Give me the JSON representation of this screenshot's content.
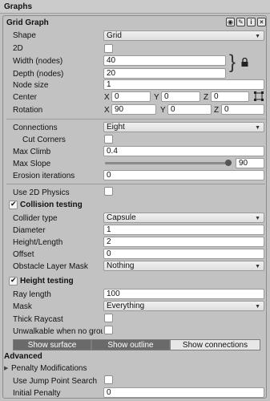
{
  "window": {
    "title": "Graphs"
  },
  "graph": {
    "title": "Grid Graph",
    "header_icons": [
      "eye-icon",
      "edit-icon",
      "info-icon",
      "close-icon"
    ],
    "shape": {
      "label": "Shape",
      "value": "Grid"
    },
    "two_d": {
      "label": "2D",
      "checked": false
    },
    "width": {
      "label": "Width (nodes)",
      "value": "40"
    },
    "depth": {
      "label": "Depth (nodes)",
      "value": "20"
    },
    "node_size": {
      "label": "Node size",
      "value": "1"
    },
    "center": {
      "label": "Center",
      "x_label": "X",
      "x": "0",
      "y_label": "Y",
      "y": "0",
      "z_label": "Z",
      "z": "0"
    },
    "rotation": {
      "label": "Rotation",
      "x_label": "X",
      "x": "90",
      "y_label": "Y",
      "y": "0",
      "z_label": "Z",
      "z": "0"
    }
  },
  "connections": {
    "connections": {
      "label": "Connections",
      "value": "Eight"
    },
    "cut_corners": {
      "label": "Cut Corners",
      "checked": false
    },
    "max_climb": {
      "label": "Max Climb",
      "value": "0.4"
    },
    "max_slope": {
      "label": "Max Slope",
      "value": "90",
      "fraction": 1.0
    },
    "erosion": {
      "label": "Erosion iterations",
      "value": "0"
    }
  },
  "physics": {
    "use_2d": {
      "label": "Use 2D Physics",
      "checked": false
    },
    "collision": {
      "label": "Collision testing",
      "checked": true
    },
    "collider_type": {
      "label": "Collider type",
      "value": "Capsule"
    },
    "diameter": {
      "label": "Diameter",
      "value": "1"
    },
    "height_length": {
      "label": "Height/Length",
      "value": "2"
    },
    "offset": {
      "label": "Offset",
      "value": "0"
    },
    "obstacle_mask": {
      "label": "Obstacle Layer Mask",
      "value": "Nothing"
    },
    "height_testing": {
      "label": "Height testing",
      "checked": true
    },
    "ray_length": {
      "label": "Ray length",
      "value": "100"
    },
    "mask": {
      "label": "Mask",
      "value": "Everything"
    },
    "thick_raycast": {
      "label": "Thick Raycast",
      "checked": false
    },
    "unwalkable": {
      "label": "Unwalkable when no groun",
      "checked": false
    }
  },
  "tabs": [
    {
      "label": "Show surface",
      "active": true
    },
    {
      "label": "Show outline",
      "active": true
    },
    {
      "label": "Show connections",
      "active": false
    }
  ],
  "advanced": {
    "title": "Advanced",
    "penalty_modifications": "Penalty Modifications",
    "jump_point": {
      "label": "Use Jump Point Search",
      "checked": false
    },
    "initial_penalty": {
      "label": "Initial Penalty",
      "value": "0"
    }
  },
  "colors": {
    "background": "#c2c2c2",
    "field": "#ffffff",
    "tab_active": "#6a6a6a",
    "tab_inactive": "#e7e7e7"
  }
}
